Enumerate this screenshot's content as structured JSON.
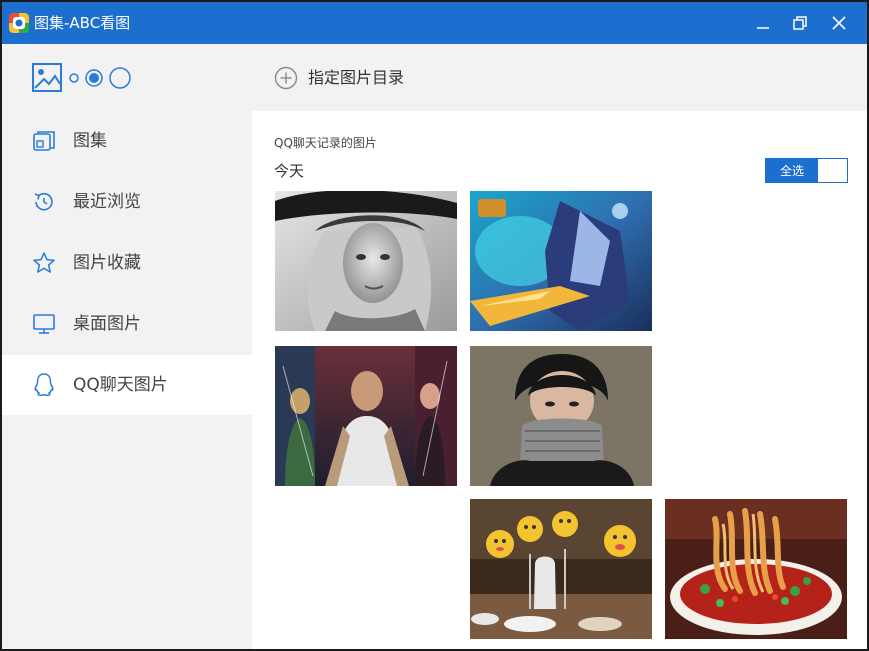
{
  "window": {
    "title": "图集-ABC看图",
    "controls": [
      "minimize-icon",
      "restore-icon",
      "close-icon"
    ]
  },
  "colors": {
    "accent": "#1c6fce",
    "sidebar_bg": "#f2f2f2",
    "active_bg": "#ffffff",
    "icon_blue": "#2c7bd8"
  },
  "sidebar": {
    "logo_icon": "image-logo-icon",
    "items": [
      {
        "label": "图集",
        "icon": "album-icon",
        "active": false
      },
      {
        "label": "最近浏览",
        "icon": "history-icon",
        "active": false
      },
      {
        "label": "图片收藏",
        "icon": "star-icon",
        "active": false
      },
      {
        "label": "桌面图片",
        "icon": "monitor-icon",
        "active": false
      },
      {
        "label": "QQ聊天图片",
        "icon": "qq-icon",
        "active": true
      }
    ]
  },
  "topbar": {
    "add_dir_label": "指定图片目录",
    "add_dir_icon": "plus-circle-icon"
  },
  "content": {
    "section_title": "QQ聊天记录的图片",
    "date_label": "今天",
    "select_all_label": "全选",
    "thumbnails": [
      {
        "subject": "portrait-hat"
      },
      {
        "subject": "game-warrior"
      },
      {
        "subject": "movie-poster"
      },
      {
        "subject": "person-scarf"
      },
      {
        "subject": "party-photo"
      },
      {
        "subject": "noodle-bowl"
      }
    ]
  }
}
